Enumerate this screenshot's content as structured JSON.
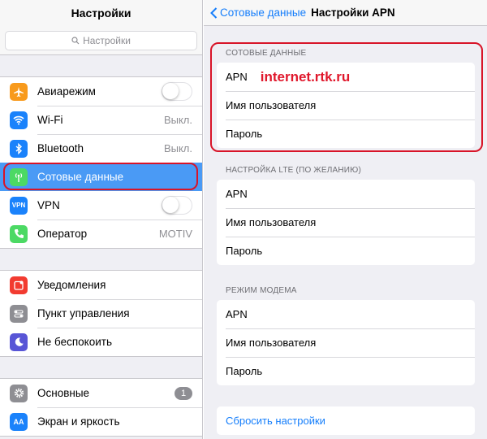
{
  "left": {
    "title": "Настройки",
    "search_placeholder": "Настройки",
    "groups": [
      [
        {
          "label": "Авиарежим",
          "icon": "airplane-icon",
          "color": "#f89a1c",
          "accessory": "toggle"
        },
        {
          "label": "Wi-Fi",
          "icon": "wifi-icon",
          "color": "#1a82fb",
          "value": "Выкл."
        },
        {
          "label": "Bluetooth",
          "icon": "bluetooth-icon",
          "color": "#1a82fb",
          "value": "Выкл."
        },
        {
          "label": "Сотовые данные",
          "icon": "cellular-antenna-icon",
          "color": "#4cd964",
          "selected": true
        },
        {
          "label": "VPN",
          "icon": "vpn-icon",
          "color": "#1a82fb",
          "accessory": "toggle",
          "icon_text": "VPN"
        },
        {
          "label": "Оператор",
          "icon": "phone-icon",
          "color": "#4cd964",
          "value": "MOTIV"
        }
      ],
      [
        {
          "label": "Уведомления",
          "icon": "notifications-icon",
          "color": "#f23b30"
        },
        {
          "label": "Пункт управления",
          "icon": "control-center-icon",
          "color": "#8e8e93"
        },
        {
          "label": "Не беспокоить",
          "icon": "moon-icon",
          "color": "#5855d6"
        }
      ],
      [
        {
          "label": "Основные",
          "icon": "gear-icon",
          "color": "#8e8e93",
          "badge": "1"
        },
        {
          "label": "Экран и яркость",
          "icon": "display-brightness-icon",
          "color": "#1a82fb",
          "icon_text": "AA"
        }
      ]
    ]
  },
  "right": {
    "back_label": "Сотовые данные",
    "title": "Настройки APN",
    "sections": [
      {
        "header": "СОТОВЫЕ ДАННЫЕ",
        "rows": [
          "APN",
          "Имя пользователя",
          "Пароль"
        ],
        "apn_value": "internet.rtk.ru"
      },
      {
        "header": "НАСТРОЙКА LTE (ПО ЖЕЛАНИЮ)",
        "rows": [
          "APN",
          "Имя пользователя",
          "Пароль"
        ]
      },
      {
        "header": "РЕЖИМ МОДЕМА",
        "rows": [
          "APN",
          "Имя пользователя",
          "Пароль"
        ]
      }
    ],
    "reset_label": "Сбросить настройки"
  },
  "colors": {
    "accent": "#157efb",
    "selected_row": "#4a9af5",
    "highlight_box": "#d81428"
  }
}
